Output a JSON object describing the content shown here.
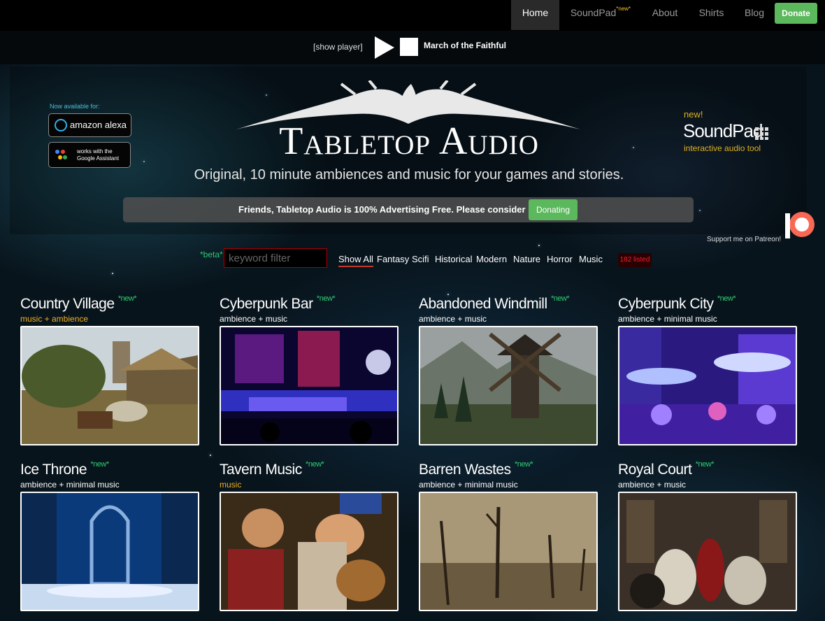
{
  "nav": {
    "items": [
      "Home",
      "SoundPad",
      "About",
      "Shirts",
      "Blog"
    ],
    "soundpad_badge": "*new*",
    "donate": "Donate"
  },
  "player": {
    "show_player": "[show player]",
    "track": "March of the Faithful"
  },
  "hero": {
    "available_label": "Now available for:",
    "alexa_label": "amazon alexa",
    "google_line1": "works with the",
    "google_line2": "Google Assistant",
    "logo_title": "Tabletop Audio",
    "tagline": "Original, 10 minute ambiences and music for your games and stories.",
    "soundpad_new": "new!",
    "soundpad_title": "SoundPad",
    "soundpad_sub": "interactive audio tool",
    "adfree_text": "Friends, Tabletop Audio is 100% Advertising Free. Please consider",
    "donating_button": "Donating",
    "patreon_label": "Support me on Patreon!"
  },
  "filter": {
    "beta": "*beta*",
    "placeholder": "keyword filter",
    "categories": [
      "Show All",
      "Fantasy",
      "Scifi",
      "Historical",
      "Modern",
      "Nature",
      "Horror",
      "Music"
    ],
    "count": "182 listed"
  },
  "tracks": [
    {
      "title": "Country Village",
      "badge": "*new*",
      "subtitle": "music + ambience",
      "gold": true
    },
    {
      "title": "Cyberpunk Bar",
      "badge": "*new*",
      "subtitle": "ambience + music",
      "gold": false
    },
    {
      "title": "Abandoned Windmill",
      "badge": "*new*",
      "subtitle": "ambience + music",
      "gold": false
    },
    {
      "title": "Cyberpunk City",
      "badge": "*new*",
      "subtitle": "ambience + minimal music",
      "gold": false
    },
    {
      "title": "Ice Throne",
      "badge": "*new*",
      "subtitle": "ambience + minimal music",
      "gold": false
    },
    {
      "title": "Tavern Music",
      "badge": "*new*",
      "subtitle": "music",
      "gold": true
    },
    {
      "title": "Barren Wastes",
      "badge": "*new*",
      "subtitle": "ambience + minimal music",
      "gold": false
    },
    {
      "title": "Royal Court",
      "badge": "*new*",
      "subtitle": "ambience + music",
      "gold": false
    }
  ],
  "colors": {
    "accent_green": "#5cb85c",
    "new_badge": "#2ecc71",
    "gold": "#f0b020",
    "alert_red": "#c0392b"
  }
}
